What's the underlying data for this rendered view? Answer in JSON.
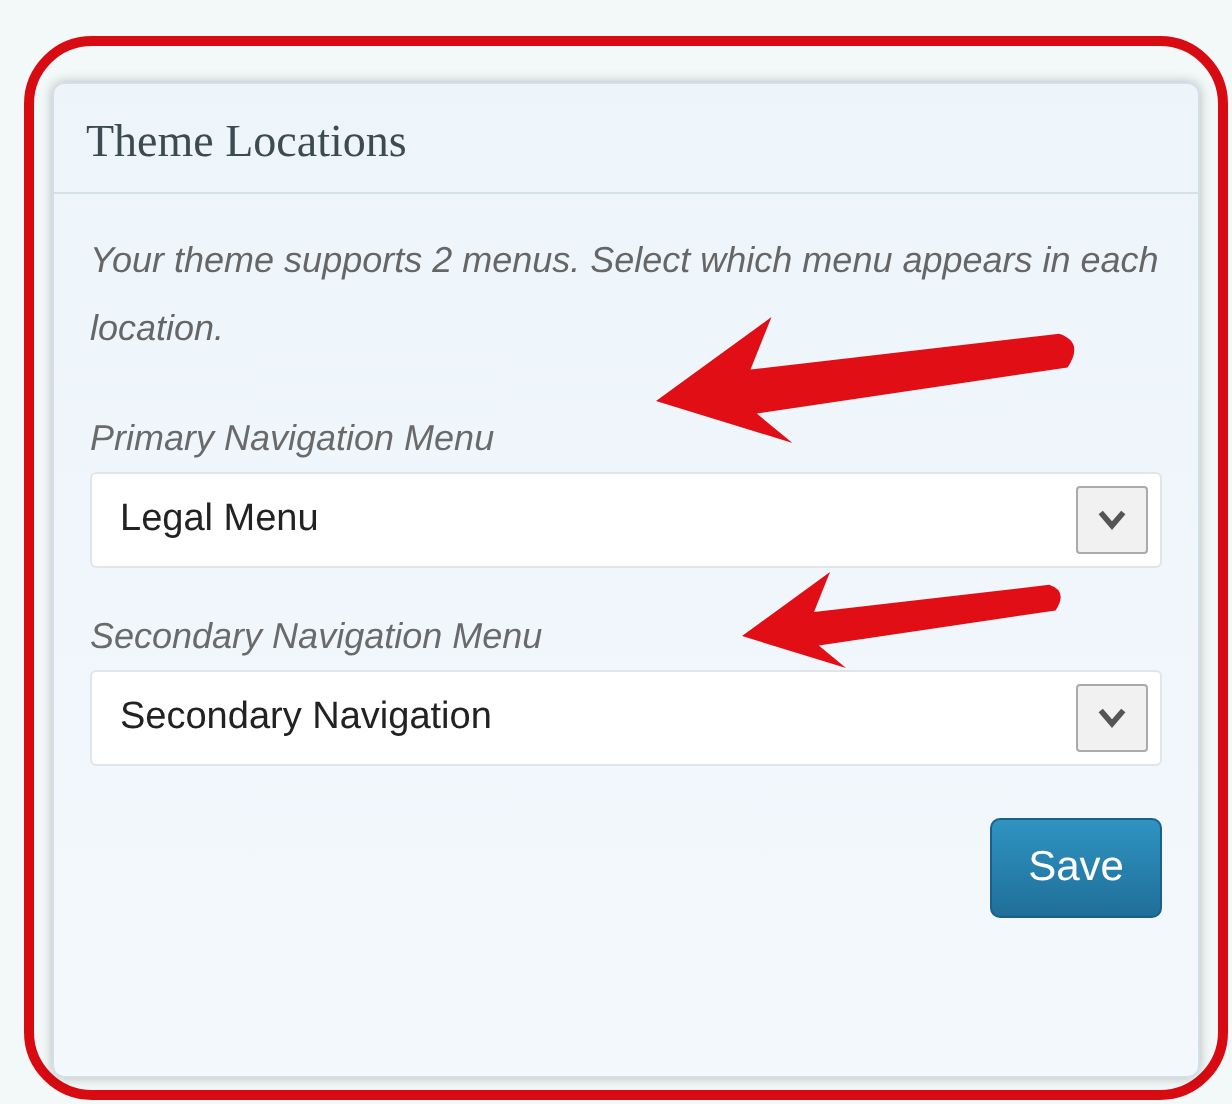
{
  "panel": {
    "title": "Theme Locations",
    "description": "Your theme supports 2 menus. Select which menu appears in each location.",
    "locations": [
      {
        "label": "Primary Navigation Menu",
        "value": "Legal Menu",
        "highlighted": true
      },
      {
        "label": "Secondary Navigation Menu",
        "value": "Secondary Navigation",
        "highlighted": true
      }
    ],
    "save_button": "Save",
    "outlined": true
  }
}
